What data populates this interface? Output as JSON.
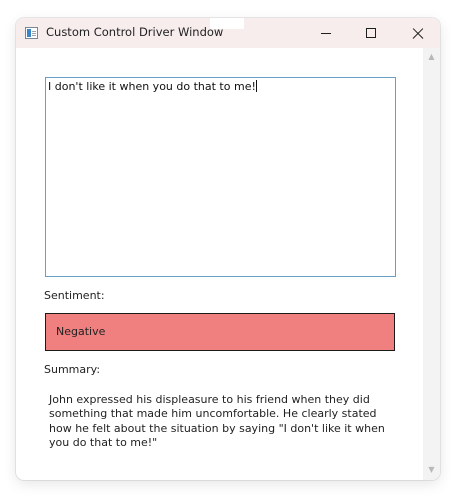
{
  "window": {
    "title": "Custom Control Driver Window"
  },
  "icons": {
    "app": "app-window-icon",
    "minimize": "minimize-icon",
    "maximize": "maximize-icon",
    "close": "close-icon",
    "scroll_up": "chevron-up-icon",
    "scroll_down": "chevron-down-icon"
  },
  "input": {
    "value": "I don't like it when you do that to me!"
  },
  "sentiment": {
    "label": "Sentiment:",
    "value": "Negative",
    "color": "#f08080"
  },
  "summary": {
    "label": "Summary:",
    "text": "John expressed his displeasure to his friend when they did something that made him uncomfortable. He clearly stated how he felt about the situation by saying \"I don't like it when you do that to me!\""
  },
  "colors": {
    "titlebar": "#f7eded",
    "textbox_border": "#6a9fc5"
  }
}
